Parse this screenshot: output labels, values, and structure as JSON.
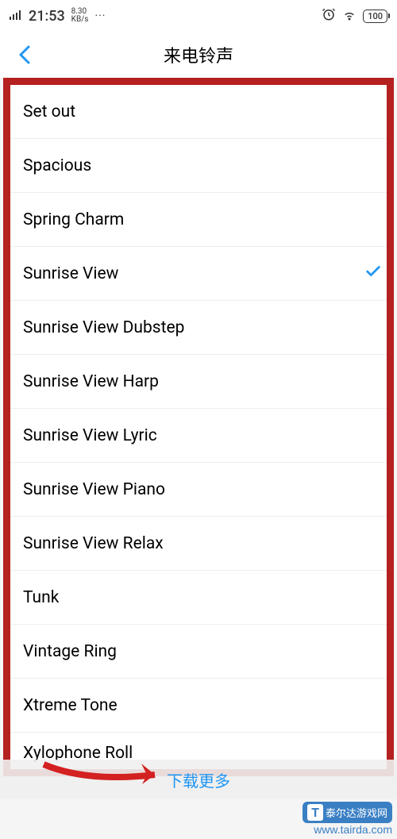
{
  "status": {
    "network": "4G HD",
    "time": "21:53",
    "speed_value": "8.30",
    "speed_unit": "KB/s",
    "dots": "···",
    "battery": "100"
  },
  "header": {
    "title": "来电铃声"
  },
  "ringtones": [
    {
      "name": "Set out",
      "selected": false
    },
    {
      "name": "Spacious",
      "selected": false
    },
    {
      "name": "Spring Charm",
      "selected": false
    },
    {
      "name": "Sunrise View",
      "selected": true
    },
    {
      "name": "Sunrise View Dubstep",
      "selected": false
    },
    {
      "name": "Sunrise View Harp",
      "selected": false
    },
    {
      "name": "Sunrise View Lyric",
      "selected": false
    },
    {
      "name": "Sunrise View Piano",
      "selected": false
    },
    {
      "name": "Sunrise View Relax",
      "selected": false
    },
    {
      "name": "Tunk",
      "selected": false
    },
    {
      "name": "Vintage Ring",
      "selected": false
    },
    {
      "name": "Xtreme Tone",
      "selected": false
    },
    {
      "name": "Xylophone Roll",
      "selected": false
    }
  ],
  "bottom": {
    "download_more": "下载更多"
  },
  "watermark": {
    "brand": "泰尔达游戏网",
    "url": "www.tairda.com"
  }
}
